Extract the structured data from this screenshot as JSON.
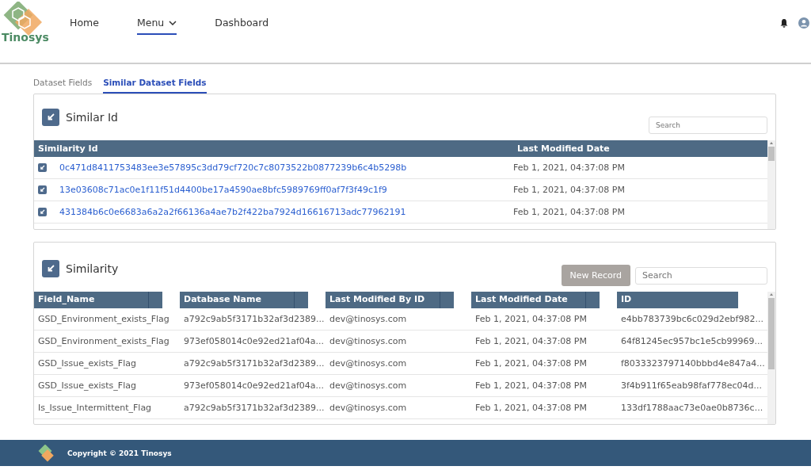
{
  "header": {
    "logo_text": "Tinosys",
    "nav": [
      {
        "label": "Home",
        "selected": false,
        "dropdown": false
      },
      {
        "label": "Menu",
        "selected": true,
        "dropdown": true
      },
      {
        "label": "Dashboard",
        "selected": false,
        "dropdown": false
      }
    ]
  },
  "tabs": [
    {
      "label": "Dataset Fields",
      "selected": false
    },
    {
      "label": "Similar Dataset Fields",
      "selected": true
    }
  ],
  "similar_id": {
    "title": "Similar Id",
    "search": {
      "placeholder": "Search"
    },
    "columns": [
      "Similarity Id",
      "Last Modified Date"
    ],
    "rows": [
      {
        "id": "0c471d8411753483ee3e57895c3dd79cf720c7c8073522b0877239b6c4b5298b",
        "date": "Feb 1, 2021, 04:37:08 PM"
      },
      {
        "id": "13e03608c71ac0e1f11f51d4400be17a4590ae8bfc5989769ff0af7f3f49c1f9",
        "date": "Feb 1, 2021, 04:37:08 PM"
      },
      {
        "id": "431384b6c0e6683a6a2a2f66136a4ae7b2f422ba7924d16616713adc77962191",
        "date": "Feb 1, 2021, 04:37:08 PM"
      }
    ]
  },
  "similarity": {
    "title": "Similarity",
    "new_record": {
      "label": "New Record",
      "disabled": true
    },
    "search": {
      "placeholder": "Search"
    },
    "columns": [
      "Field_Name",
      "Database Name",
      "Last Modified By ID",
      "Last Modified Date",
      "ID"
    ],
    "rows": [
      [
        "GSD_Environment_exists_Flag",
        "a792c9ab5f3171b32af3d2389...",
        "dev@tinosys.com",
        "Feb 1, 2021, 04:37:08 PM",
        "e4bb783739bc6c029d2ebf982..."
      ],
      [
        "GSD_Environment_exists_Flag",
        "973ef058014c0e92ed21af04a...",
        "dev@tinosys.com",
        "Feb 1, 2021, 04:37:08 PM",
        "64f81245ec957bc1e5cb99969..."
      ],
      [
        "GSD_Issue_exists_Flag",
        "a792c9ab5f3171b32af3d2389...",
        "dev@tinosys.com",
        "Feb 1, 2021, 04:37:08 PM",
        "f8033323797140bbbd4e847a4..."
      ],
      [
        "GSD_Issue_exists_Flag",
        "973ef058014c0e92ed21af04a...",
        "dev@tinosys.com",
        "Feb 1, 2021, 04:37:08 PM",
        "3f4b911f65eab98faf778ec04d..."
      ],
      [
        "Is_Issue_Intermittent_Flag",
        "a792c9ab5f3171b32af3d2389...",
        "dev@tinosys.com",
        "Feb 1, 2021, 04:37:08 PM",
        "133df1788aac73e0ae0b8736c..."
      ]
    ]
  },
  "footer": {
    "copyright": "Copyright © 2021 Tinosys"
  }
}
